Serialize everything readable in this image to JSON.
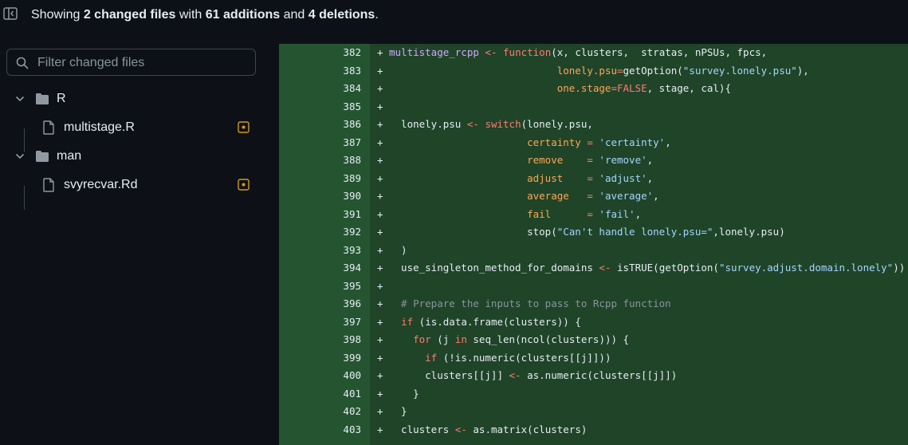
{
  "header": {
    "summary_prefix": "Showing",
    "changed_files": "2 changed files",
    "with_text": "with",
    "additions": "61 additions",
    "and_text": "and",
    "deletions": "4 deletions",
    "period": "."
  },
  "sidebar": {
    "filter_placeholder": "Filter changed files",
    "tree": [
      {
        "type": "folder",
        "name": "R"
      },
      {
        "type": "file",
        "name": "multistage.R",
        "status": "modified"
      },
      {
        "type": "folder",
        "name": "man"
      },
      {
        "type": "file",
        "name": "svyrecvar.Rd",
        "status": "modified"
      }
    ]
  },
  "colors": {
    "add_bg": "#1f4428",
    "gutter_bg": "#245530",
    "keyword": "#ff7b72",
    "string": "#a5d6ff",
    "function": "#d2a8ff",
    "param": "#ffa657",
    "comment": "#8b949e",
    "modified_icon": "#d29922"
  },
  "diff": {
    "lines": [
      {
        "num": "382",
        "sign": "+",
        "code": "multistage_rcpp <- function(x, clusters,  stratas, nPSUs, fpcs,"
      },
      {
        "num": "383",
        "sign": "+",
        "code": "                            lonely.psu=getOption(\"survey.lonely.psu\"),"
      },
      {
        "num": "384",
        "sign": "+",
        "code": "                            one.stage=FALSE, stage, cal){"
      },
      {
        "num": "385",
        "sign": "+",
        "code": ""
      },
      {
        "num": "386",
        "sign": "+",
        "code": "  lonely.psu <- switch(lonely.psu,"
      },
      {
        "num": "387",
        "sign": "+",
        "code": "                       certainty = 'certainty',"
      },
      {
        "num": "388",
        "sign": "+",
        "code": "                       remove    = 'remove',"
      },
      {
        "num": "389",
        "sign": "+",
        "code": "                       adjust    = 'adjust',"
      },
      {
        "num": "390",
        "sign": "+",
        "code": "                       average   = 'average',"
      },
      {
        "num": "391",
        "sign": "+",
        "code": "                       fail      = 'fail',"
      },
      {
        "num": "392",
        "sign": "+",
        "code": "                       stop(\"Can't handle lonely.psu=\",lonely.psu)"
      },
      {
        "num": "393",
        "sign": "+",
        "code": "  )"
      },
      {
        "num": "394",
        "sign": "+",
        "code": "  use_singleton_method_for_domains <- isTRUE(getOption(\"survey.adjust.domain.lonely\"))"
      },
      {
        "num": "395",
        "sign": "+",
        "code": ""
      },
      {
        "num": "396",
        "sign": "+",
        "code": "  # Prepare the inputs to pass to Rcpp function"
      },
      {
        "num": "397",
        "sign": "+",
        "code": "  if (is.data.frame(clusters)) {"
      },
      {
        "num": "398",
        "sign": "+",
        "code": "    for (j in seq_len(ncol(clusters))) {"
      },
      {
        "num": "399",
        "sign": "+",
        "code": "      if (!is.numeric(clusters[[j]]))"
      },
      {
        "num": "400",
        "sign": "+",
        "code": "      clusters[[j]] <- as.numeric(clusters[[j]])"
      },
      {
        "num": "401",
        "sign": "+",
        "code": "    }"
      },
      {
        "num": "402",
        "sign": "+",
        "code": "  }"
      },
      {
        "num": "403",
        "sign": "+",
        "code": "  clusters <- as.matrix(clusters)"
      }
    ]
  }
}
